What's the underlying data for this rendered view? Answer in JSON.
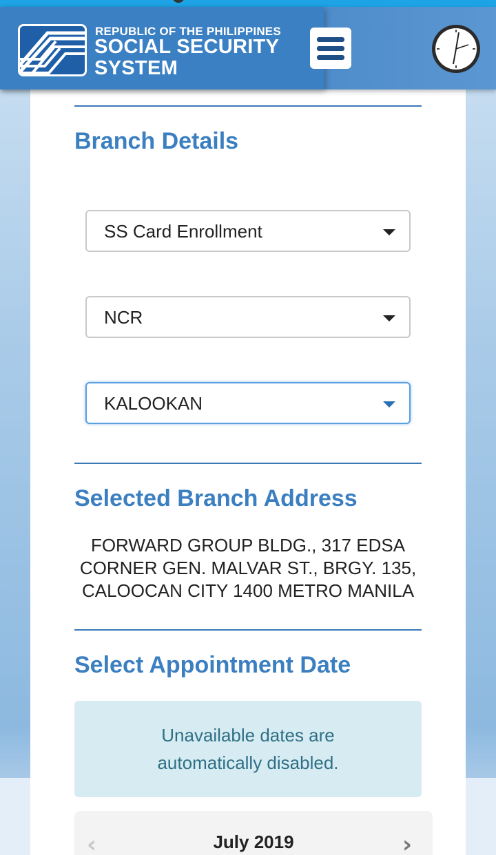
{
  "header": {
    "brand_line1": "REPUBLIC OF THE PHILIPPINES",
    "brand_line2": "SOCIAL SECURITY",
    "brand_line3": "SYSTEM"
  },
  "branch_details": {
    "title": "Branch Details",
    "service_select": {
      "value": "SS Card Enrollment"
    },
    "region_select": {
      "value": "NCR"
    },
    "branch_select": {
      "value": "KALOOKAN"
    }
  },
  "selected_branch": {
    "title": "Selected Branch Address",
    "address_lines": [
      "FORWARD GROUP BLDG., 317 EDSA",
      "CORNER GEN. MALVAR ST., BRGY. 135,",
      "CALOOCAN CITY 1400 METRO MANILA"
    ]
  },
  "appointment": {
    "title": "Select Appointment Date",
    "info_lines": [
      "Unavailable dates are",
      "automatically disabled."
    ],
    "calendar": {
      "month_label": "July 2019",
      "prev_symbol": "‹",
      "next_symbol": "›"
    }
  },
  "colors": {
    "accent": "#3b7fc1",
    "header_bg": "#3b80c3",
    "info_bg": "#d7ecf2",
    "info_text": "#2f6f86"
  },
  "icons": {
    "menu": "hamburger-menu-icon",
    "clock": "clock-icon",
    "logo": "sss-logo",
    "prev": "chevron-left-icon",
    "next": "chevron-right-icon",
    "caret": "caret-down-icon"
  }
}
